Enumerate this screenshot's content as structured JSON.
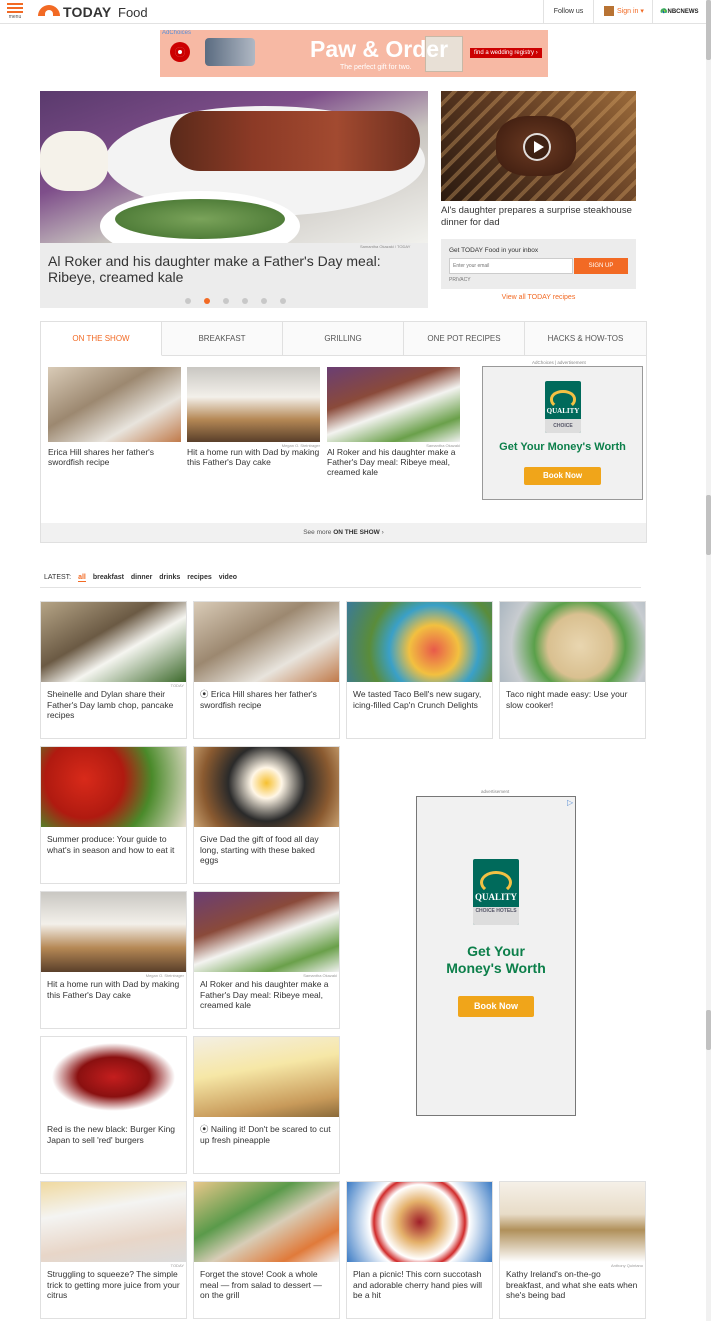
{
  "header": {
    "menu_label": "menu",
    "logo_text": "TODAY",
    "section": "Food",
    "follow_label": "Follow us",
    "signin_label": "Sign in ▾",
    "network": "NBCNEWS"
  },
  "top_ad": {
    "adchoices": "AdChoices",
    "headline": "Paw & Order",
    "subline": "The perfect gift for two.",
    "cta": "find a wedding registry ›"
  },
  "hero": {
    "credit": "Samantha Okazaki / TODAY",
    "caption": "Al Roker and his daughter make a Father's Day meal: Ribeye, creamed kale",
    "slides": 6,
    "active_slide": 2
  },
  "side_story": {
    "caption": "Al's daughter prepares a surprise steakhouse dinner for dad"
  },
  "newsletter": {
    "title": "Get TODAY Food in your inbox",
    "placeholder": "Enter your email",
    "button": "SIGN UP",
    "privacy": "PRIVACY"
  },
  "view_all": "View all TODAY recipes",
  "tabs": {
    "items": [
      {
        "label": "ON THE SHOW",
        "active": true
      },
      {
        "label": "BREAKFAST"
      },
      {
        "label": "GRILLING"
      },
      {
        "label": "ONE POT RECIPES"
      },
      {
        "label": "HACKS & HOW-TOS"
      }
    ],
    "cards": [
      {
        "caption": "Erica Hill shares her father's swordfish recipe",
        "credit": ""
      },
      {
        "caption": "Hit a home run with Dad by making this Father's Day cake",
        "credit": "Megan O. Steintrager"
      },
      {
        "caption": "Al Roker and his daughter make a Father's Day meal: Ribeye meal, creamed kale",
        "credit": "Samantha Okazaki"
      }
    ],
    "see_more_prefix": "See more ",
    "see_more_bold": "ON THE SHOW",
    "see_more_suffix": " ›"
  },
  "ad_small": {
    "label": "AdChoices | advertisement",
    "brand": "QUALITY",
    "choice": "CHOICE",
    "headline": "Get Your Money's Worth",
    "button": "Book Now"
  },
  "ad_large": {
    "label": "advertisement",
    "brand": "QUALITY",
    "choice": "CHOICE HOTELS",
    "headline_1": "Get Your",
    "headline_2": "Money's Worth",
    "button": "Book Now"
  },
  "latest": {
    "label": "LATEST:",
    "filters": [
      "all",
      "breakfast",
      "dinner",
      "drinks",
      "recipes",
      "video"
    ],
    "active": "all"
  },
  "cards": [
    {
      "caption": "Sheinelle and Dylan share their Father's Day lamb chop, pancake recipes",
      "credit": "TODAY",
      "video": false
    },
    {
      "caption": "Erica Hill shares her father's swordfish recipe",
      "credit": "",
      "video": true
    },
    {
      "caption": "We tasted Taco Bell's new sugary, icing-filled Cap'n Crunch Delights",
      "credit": "",
      "video": false
    },
    {
      "caption": "Taco night made easy: Use your slow cooker!",
      "credit": "",
      "video": false
    },
    {
      "caption": "Summer produce: Your guide to what's in season and how to eat it",
      "credit": "",
      "video": false
    },
    {
      "caption": "Give Dad the gift of food all day long, starting with these baked eggs",
      "credit": "",
      "video": false
    },
    {
      "caption": "Hit a home run with Dad by making this Father's Day cake",
      "credit": "Megan O. Steintrager",
      "video": false
    },
    {
      "caption": "Al Roker and his daughter make a Father's Day meal: Ribeye meal, creamed kale",
      "credit": "Samantha Okazaki",
      "video": false
    },
    {
      "caption": "Red is the new black: Burger King Japan to sell 'red' burgers",
      "credit": "",
      "video": false
    },
    {
      "caption": "Nailing it! Don't be scared to cut up fresh pineapple",
      "credit": "",
      "video": true
    },
    {
      "caption": "Struggling to squeeze? The simple trick to getting more juice from your citrus",
      "credit": "TODAY",
      "video": false
    },
    {
      "caption": "Forget the stove! Cook a whole meal — from salad to dessert — on the grill",
      "credit": "",
      "video": false
    },
    {
      "caption": "Plan a picnic! This corn succotash and adorable cherry hand pies will be a hit",
      "credit": "",
      "video": false
    },
    {
      "caption": "Kathy Ireland's on-the-go breakfast, and what she eats when she's being bad",
      "credit": "Anthony Quintano",
      "video": false
    }
  ],
  "colors": {
    "accent": "#f26a24",
    "ad_green": "#0c7f4a",
    "ad_button": "#f0a51a"
  }
}
